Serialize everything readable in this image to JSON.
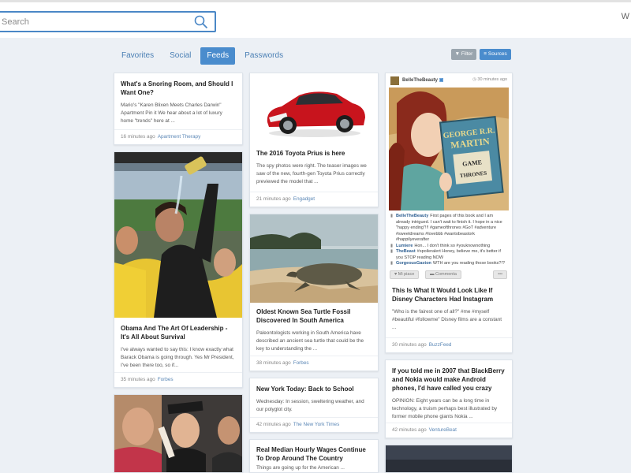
{
  "search": {
    "placeholder": "Search"
  },
  "corner_letter": "W",
  "tabs": [
    {
      "label": "Favorites",
      "active": false
    },
    {
      "label": "Social",
      "active": false
    },
    {
      "label": "Feeds",
      "active": true
    },
    {
      "label": "Passwords",
      "active": false
    }
  ],
  "toolbar": {
    "filter_label": "Filter",
    "sources_label": "Sources"
  },
  "cards": {
    "snoring": {
      "title": "What's a Snoring Room, and Should I Want One?",
      "excerpt": "Mario's \"Karen Blixen Meets Charles Darwin\" Apartment Pin it We hear about a lot of luxury home \"trends\" here at ...",
      "time": "16 minutes ago",
      "source": "Apartment Therapy"
    },
    "obama": {
      "title": "Obama And The Art Of Leadership - It's All About Survival",
      "excerpt": "I've always wanted to say this: I know exactly what Barack Obama is going through. Yes Mr President, I've been there too, so if...",
      "time": "35 minutes ago",
      "source": "Forbes"
    },
    "prius": {
      "title": "The 2016 Toyota Prius is here",
      "excerpt": "The spy photos were right. The teaser images we saw of the new, fourth-gen Toyota Prius correctly previewed the model that ...",
      "time": "21 minutes ago",
      "source": "Engadget"
    },
    "turtle": {
      "title": "Oldest Known Sea Turtle Fossil Discovered In South America",
      "excerpt": "Paleontologists working in South America have described an ancient sea turtle that could be the key to understanding the ...",
      "time": "38 minutes ago",
      "source": "Forbes"
    },
    "nytoday": {
      "title": "New York Today: Back to School",
      "excerpt": "Wednesday: In session, sweltering weather, and our polyglot city.",
      "time": "42 minutes ago",
      "source": "The New York Times"
    },
    "wages": {
      "title": "Real Median Hourly Wages Continue To Drop Around The Country",
      "excerpt": "Things are going up for the American ..."
    },
    "instagram": {
      "user": "BelleTheBeauty",
      "time": "30 minutes ago",
      "book_line1": "GEORGE R.R.",
      "book_line2": "MARTIN",
      "book_line3": "GAME",
      "book_line4": "THRONES",
      "comments": [
        {
          "user": "BelleTheBeauty",
          "text": "First pages of this book and I am already intrigued. I can't wait to finish it. I hope in a nice \"happy ending\"!!! #gameofthrones #GoT #adventure #sweetdreams #lovebbb #wantobeastork #happilyeverafter"
        },
        {
          "user": "Lumiere",
          "text": "Hon... I don't think so #youknownothing"
        },
        {
          "user": "TheBeast",
          "text": "#spoileralert Honey, believe me, it's better if you STOP reading NOW"
        },
        {
          "user": "GorgeousGaston",
          "text": "WTH are you reading those books?!?"
        }
      ],
      "like_label": "♥ Mi piace",
      "comment_label": "▬ Commenta",
      "more_label": "•••",
      "title": "This Is What It Would Look Like If Disney Characters Had Instagram",
      "excerpt": "\"Who is the fairest one of all?\" #me #myself #beautiful #followme\" Disney films are a constant ...",
      "source": "BuzzFeed"
    },
    "blackberry": {
      "title": "If you told me in 2007 that BlackBerry and Nokia would make Android phones, I'd have called you crazy",
      "excerpt": "OPINION: Eight years can be a long time in technology, a truism perhaps best illustrated by former mobile phone giants Nokia ...",
      "time": "42 minutes ago",
      "source": "VentureBeat"
    }
  }
}
